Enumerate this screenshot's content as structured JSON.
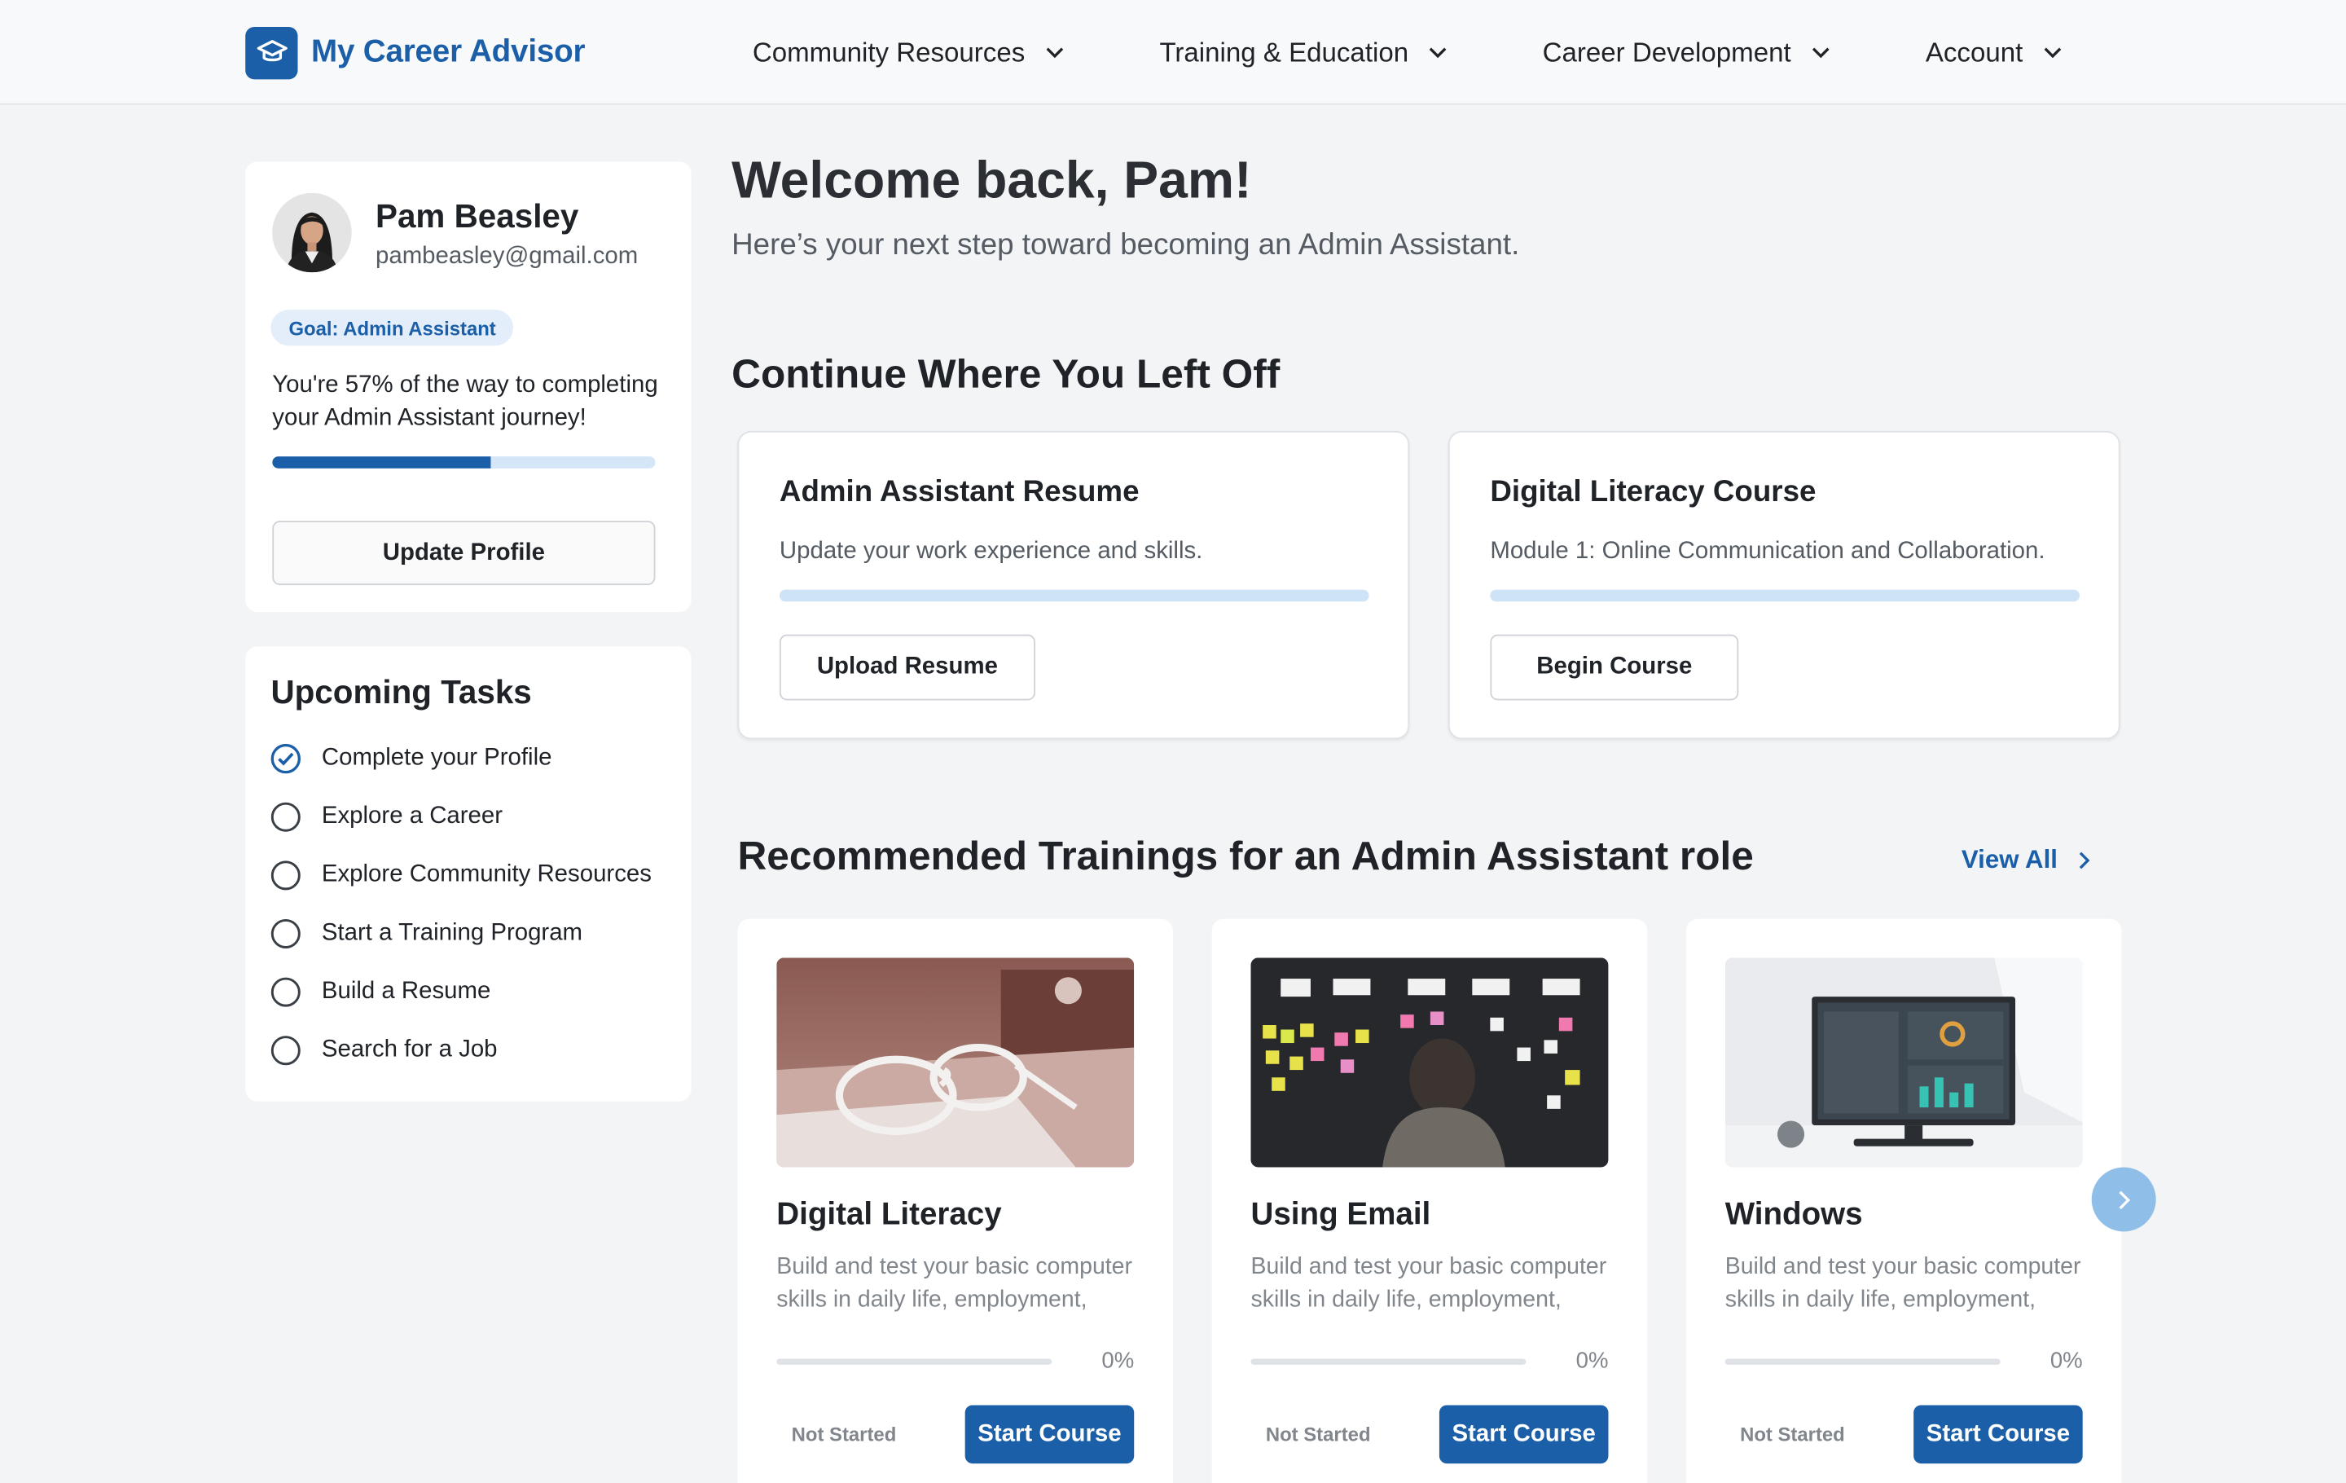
{
  "app": {
    "name": "My Career Advisor",
    "brand_color": "#1b5fa8"
  },
  "nav": {
    "items": [
      {
        "label": "Community Resources",
        "icon": "chevron-down-icon"
      },
      {
        "label": "Training & Education",
        "icon": "chevron-down-icon"
      },
      {
        "label": "Career Development",
        "icon": "chevron-down-icon"
      },
      {
        "label": "Account",
        "icon": "chevron-down-icon"
      }
    ]
  },
  "profile": {
    "name": "Pam Beasley",
    "email": "pambeasley@gmail.com",
    "goal": "Goal: Admin Assistant",
    "progress_text": "You're 57% of the way to completing your Admin Assistant journey!",
    "progress": 0.57,
    "update_label": "Update Profile"
  },
  "tasks": {
    "title": "Upcoming Tasks",
    "items": [
      {
        "label": "Complete your Profile",
        "done": true
      },
      {
        "label": "Explore a Career",
        "done": false
      },
      {
        "label": "Explore Community Resources",
        "done": false
      },
      {
        "label": "Start a Training Program",
        "done": false
      },
      {
        "label": "Build a Resume",
        "done": false
      },
      {
        "label": "Search for a Job",
        "done": false
      }
    ]
  },
  "main": {
    "welcome": "Welcome back, Pam!",
    "subtitle": "Here’s your next step toward becoming an Admin Assistant.",
    "continue_title": "Continue Where You Left Off",
    "continue_cards": [
      {
        "title": "Admin Assistant Resume",
        "desc": "Update your work experience and skills.",
        "progress": 0,
        "button": "Upload Resume"
      },
      {
        "title": "Digital Literacy Course",
        "desc": "Module 1: Online Communication and Collaboration.",
        "progress": 0,
        "button": "Begin Course"
      }
    ],
    "recommended_title": "Recommended Trainings for an Admin Assistant role",
    "view_all": "View All",
    "trainings": [
      {
        "title": "Digital Literacy",
        "desc": "Build and test your basic computer skills in daily life, employment,",
        "progress_pct": "0%",
        "progress": 0,
        "status": "Not Started",
        "button": "Start Course",
        "image": "sunglasses-on-laptop-photo"
      },
      {
        "title": "Using Email",
        "desc": "Build and test your basic computer skills in daily life, employment,",
        "progress_pct": "0%",
        "progress": 0,
        "status": "Not Started",
        "button": "Start Course",
        "image": "sticky-note-board-photo"
      },
      {
        "title": "Windows",
        "desc": "Build and test your basic computer skills in daily life, employment,",
        "progress_pct": "0%",
        "progress": 0,
        "status": "Not Started",
        "button": "Start Course",
        "image": "desktop-monitor-photo"
      }
    ],
    "carousel_next_icon": "chevron-right-icon"
  }
}
